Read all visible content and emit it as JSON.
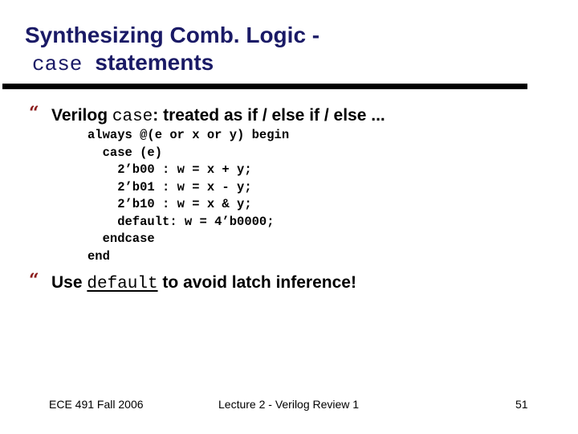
{
  "slide": {
    "title": {
      "line1": "Synthesizing Comb. Logic -",
      "line2_code": "case",
      "line2_text": "statements"
    },
    "bullets": [
      {
        "icon": "quote-bullet-icon",
        "prefix": "Verilog ",
        "code": "case",
        "suffix": ": treated as if / else if / else ..."
      },
      {
        "icon": "quote-bullet-icon",
        "prefix": "Use ",
        "code": "default",
        "suffix": " to avoid latch inference!"
      }
    ],
    "code_lines": [
      "always @(e or x or y) begin",
      "  case (e)",
      "    2’b00 : w = x + y;",
      "    2’b01 : w = x - y;",
      "    2’b10 : w = x & y;",
      "    default: w = 4’b0000;",
      "  endcase",
      "end"
    ],
    "bullet_glyph": "“",
    "colors": {
      "title": "#1a1a66",
      "bullet": "#8b1a1a",
      "rule": "#000000"
    }
  },
  "footer": {
    "left": "ECE 491 Fall 2006",
    "center": "Lecture 2 - Verilog Review 1",
    "page_number": "51"
  }
}
